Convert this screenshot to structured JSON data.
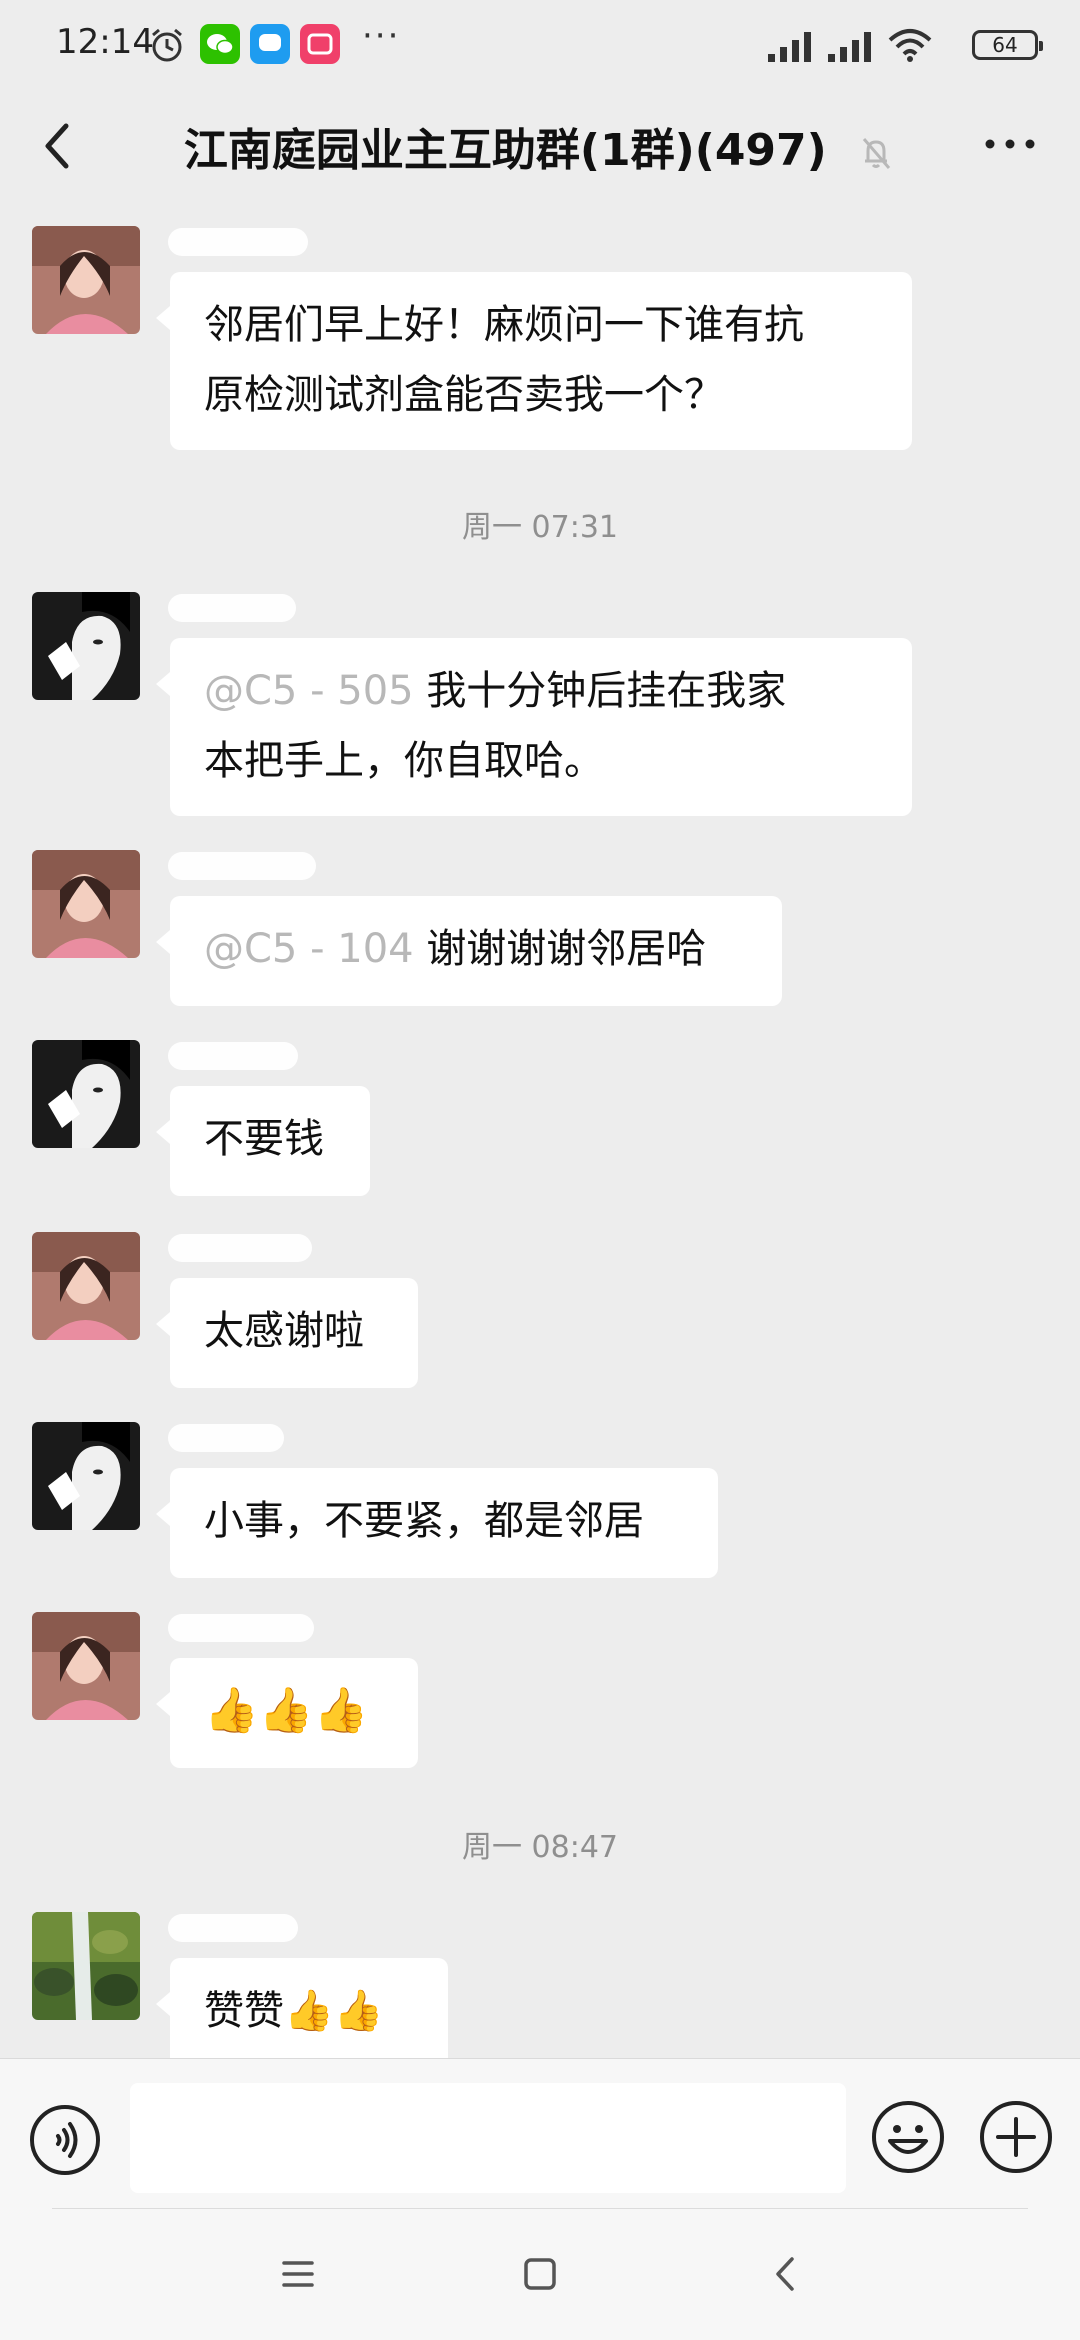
{
  "status_bar": {
    "time": "12:14",
    "more": "···",
    "battery": "64"
  },
  "header": {
    "title": "江南庭园业主互助群(1群)(497)",
    "back_icon": "chevron-left-icon",
    "mute_icon": "bell-off-icon",
    "more_icon": "more-dots-icon"
  },
  "chat": {
    "timestamps": [
      "周一 07:31",
      "周一 08:47"
    ],
    "messages": [
      {
        "sender": "pink",
        "text_line1": "邻居们早上好！麻烦问一下谁有抗",
        "text_line2": "原检测试剂盒能否卖我一个？"
      },
      {
        "sender": "bw",
        "at_mask": "@C5 - 505",
        "text_line1": "我十分钟后挂在我家",
        "text_line2": "本把手上，你自取哈。"
      },
      {
        "sender": "pink",
        "at_mask": "@C5 - 104",
        "text": "谢谢谢谢邻居哈"
      },
      {
        "sender": "bw",
        "text": "不要钱"
      },
      {
        "sender": "pink",
        "text": "太感谢啦"
      },
      {
        "sender": "bw",
        "text": "小事，不要紧，都是邻居"
      },
      {
        "sender": "pink",
        "text": "👍👍👍"
      },
      {
        "sender": "nature",
        "text": "赞赞👍👍"
      }
    ]
  },
  "input_bar": {
    "placeholder": "",
    "voice_icon": "voice-icon",
    "emoji_icon": "emoji-icon",
    "plus_icon": "plus-circle-icon"
  },
  "colors": {
    "background": "#ededed",
    "bubble": "#ffffff",
    "timestamp": "#8f8f8f"
  }
}
